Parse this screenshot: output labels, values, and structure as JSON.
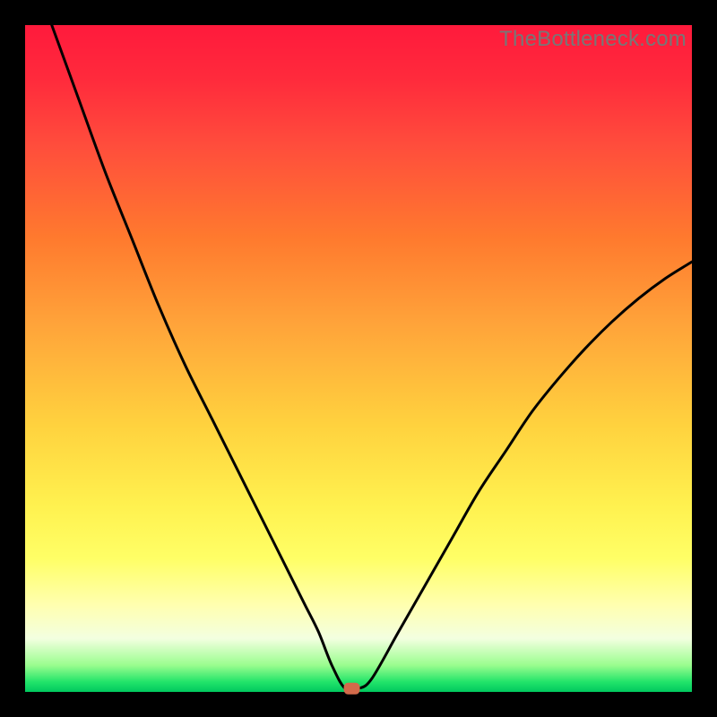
{
  "watermark": "TheBottleneck.com",
  "chart_data": {
    "type": "line",
    "title": "",
    "xlabel": "",
    "ylabel": "",
    "xlim": [
      0,
      100
    ],
    "ylim": [
      0,
      100
    ],
    "grid": false,
    "legend": false,
    "series": [
      {
        "name": "curve",
        "x": [
          4,
          8,
          12,
          16,
          20,
          24,
          28,
          32,
          34,
          36,
          38,
          40,
          42,
          44,
          46,
          48,
          50,
          52,
          56,
          60,
          64,
          68,
          72,
          76,
          80,
          84,
          88,
          92,
          96,
          100
        ],
        "y": [
          100,
          89,
          78,
          68,
          58,
          49,
          41,
          33,
          29,
          25,
          21,
          17,
          13,
          9,
          4,
          0.5,
          0.5,
          2,
          9,
          16,
          23,
          30,
          36,
          42,
          47,
          51.5,
          55.5,
          59,
          62,
          64.5
        ]
      }
    ],
    "marker": {
      "x": 49,
      "y": 0.5
    },
    "background_gradient": {
      "stops": [
        {
          "pct": 0,
          "color": "#ff1a3c"
        },
        {
          "pct": 45,
          "color": "#ffa43a"
        },
        {
          "pct": 80,
          "color": "#ffff66"
        },
        {
          "pct": 100,
          "color": "#00c85f"
        }
      ]
    }
  }
}
